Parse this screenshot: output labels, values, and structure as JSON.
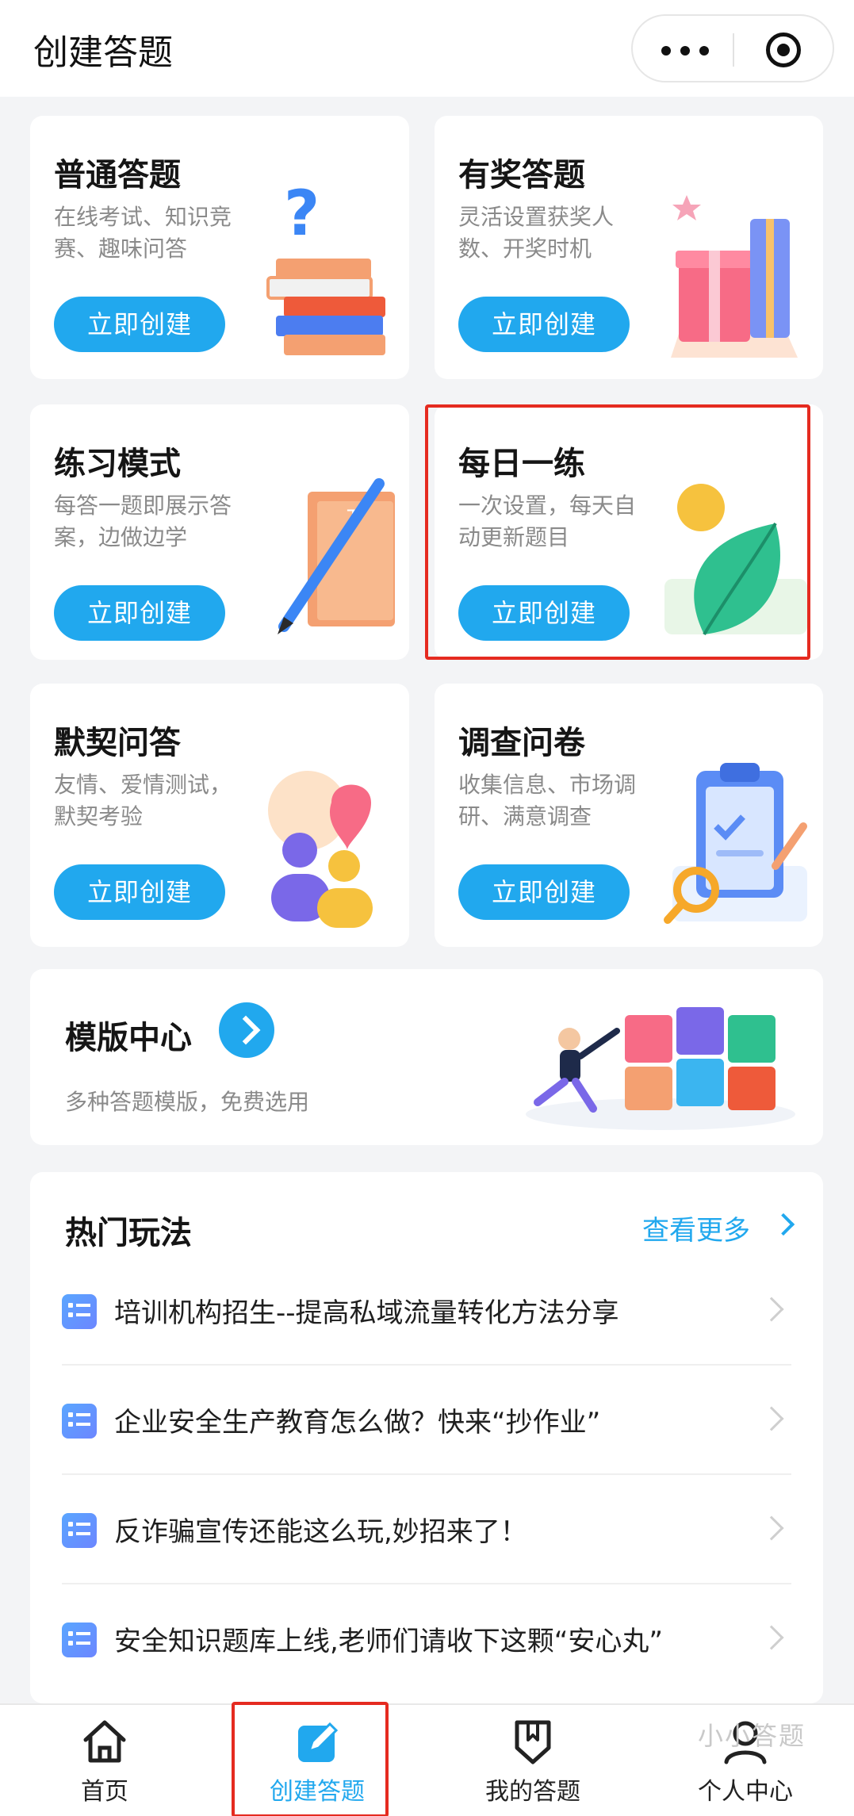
{
  "header": {
    "title": "创建答题"
  },
  "cards": [
    {
      "title": "普通答题",
      "desc": "在线考试、知识竞赛、趣味问答",
      "button": "立即创建"
    },
    {
      "title": "有奖答题",
      "desc": "灵活设置获奖人数、开奖时机",
      "button": "立即创建"
    },
    {
      "title": "练习模式",
      "desc": "每答一题即展示答案，边做边学",
      "button": "立即创建"
    },
    {
      "title": "每日一练",
      "desc": "一次设置，每天自动更新题目",
      "button": "立即创建"
    },
    {
      "title": "默契问答",
      "desc": "友情、爱情测试，默契考验",
      "button": "立即创建"
    },
    {
      "title": "调查问卷",
      "desc": "收集信息、市场调研、满意调查",
      "button": "立即创建"
    }
  ],
  "template_center": {
    "title": "模版中心",
    "desc": "多种答题模版，免费选用"
  },
  "hot": {
    "title": "热门玩法",
    "more": "查看更多",
    "items": [
      "培训机构招生--提高私域流量转化方法分享",
      "企业安全生产教育怎么做？快来“抄作业”",
      "反诈骗宣传还能这么玩,妙招来了！",
      "安全知识题库上线,老师们请收下这颗“安心丸”"
    ]
  },
  "tabbar": {
    "items": [
      {
        "label": "首页",
        "icon": "home-icon"
      },
      {
        "label": "创建答题",
        "icon": "edit-icon",
        "active": true
      },
      {
        "label": "我的答题",
        "icon": "shield-icon"
      },
      {
        "label": "个人中心",
        "icon": "user-icon"
      }
    ]
  },
  "watermark": "小小答题",
  "colors": {
    "accent": "#21a8ee",
    "highlight": "#e52b20",
    "background": "#f3f4f6"
  }
}
